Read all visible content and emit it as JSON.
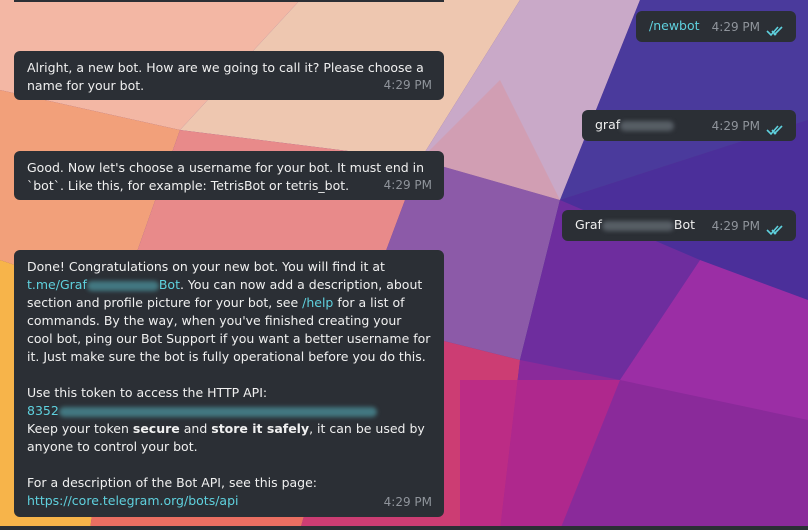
{
  "messages": {
    "m1": {
      "text": "/newbot",
      "time": "4:29 PM"
    },
    "m2": {
      "text": "Alright, a new bot. How are we going to call it? Please choose a name for your bot.",
      "time": "4:29 PM"
    },
    "m3": {
      "prefix": "graf",
      "time": "4:29 PM"
    },
    "m4": {
      "text": "Good. Now let's choose a username for your bot. It must end in `bot`. Like this, for example: TetrisBot or tetris_bot.",
      "time": "4:29 PM"
    },
    "m5": {
      "prefix": "Graf",
      "suffix": "Bot",
      "time": "4:29 PM"
    },
    "m6": {
      "p1_a": "Done! Congratulations on your new bot. You will find it at",
      "link_prefix": "t.me/Graf",
      "link_suffix": "Bot",
      "p1_b": ". You can now add a description, about section and profile picture for your bot, see",
      "help_link": "/help",
      "p1_c": "for a list of commands. By the way, when you've finished creating your cool bot, ping our Bot Support if you want a better username for it. Just make sure the bot is fully operational before you do this.",
      "token_label": "Use this token to access the HTTP API:",
      "token_prefix": "8352",
      "p3_a": "Keep your token",
      "p3_b1": "secure",
      "p3_and": "and",
      "p3_b2": "store it safely",
      "p3_c": ", it can be used by anyone to control your bot.",
      "p4": "For a description of the Bot API, see this page:",
      "api_link": "https://core.telegram.org/bots/api",
      "time": "4:29 PM"
    }
  },
  "colors": {
    "bubble": "#2b2f35",
    "link": "#5fd1de",
    "time": "#8f949b",
    "tick": "#5fd1de"
  }
}
